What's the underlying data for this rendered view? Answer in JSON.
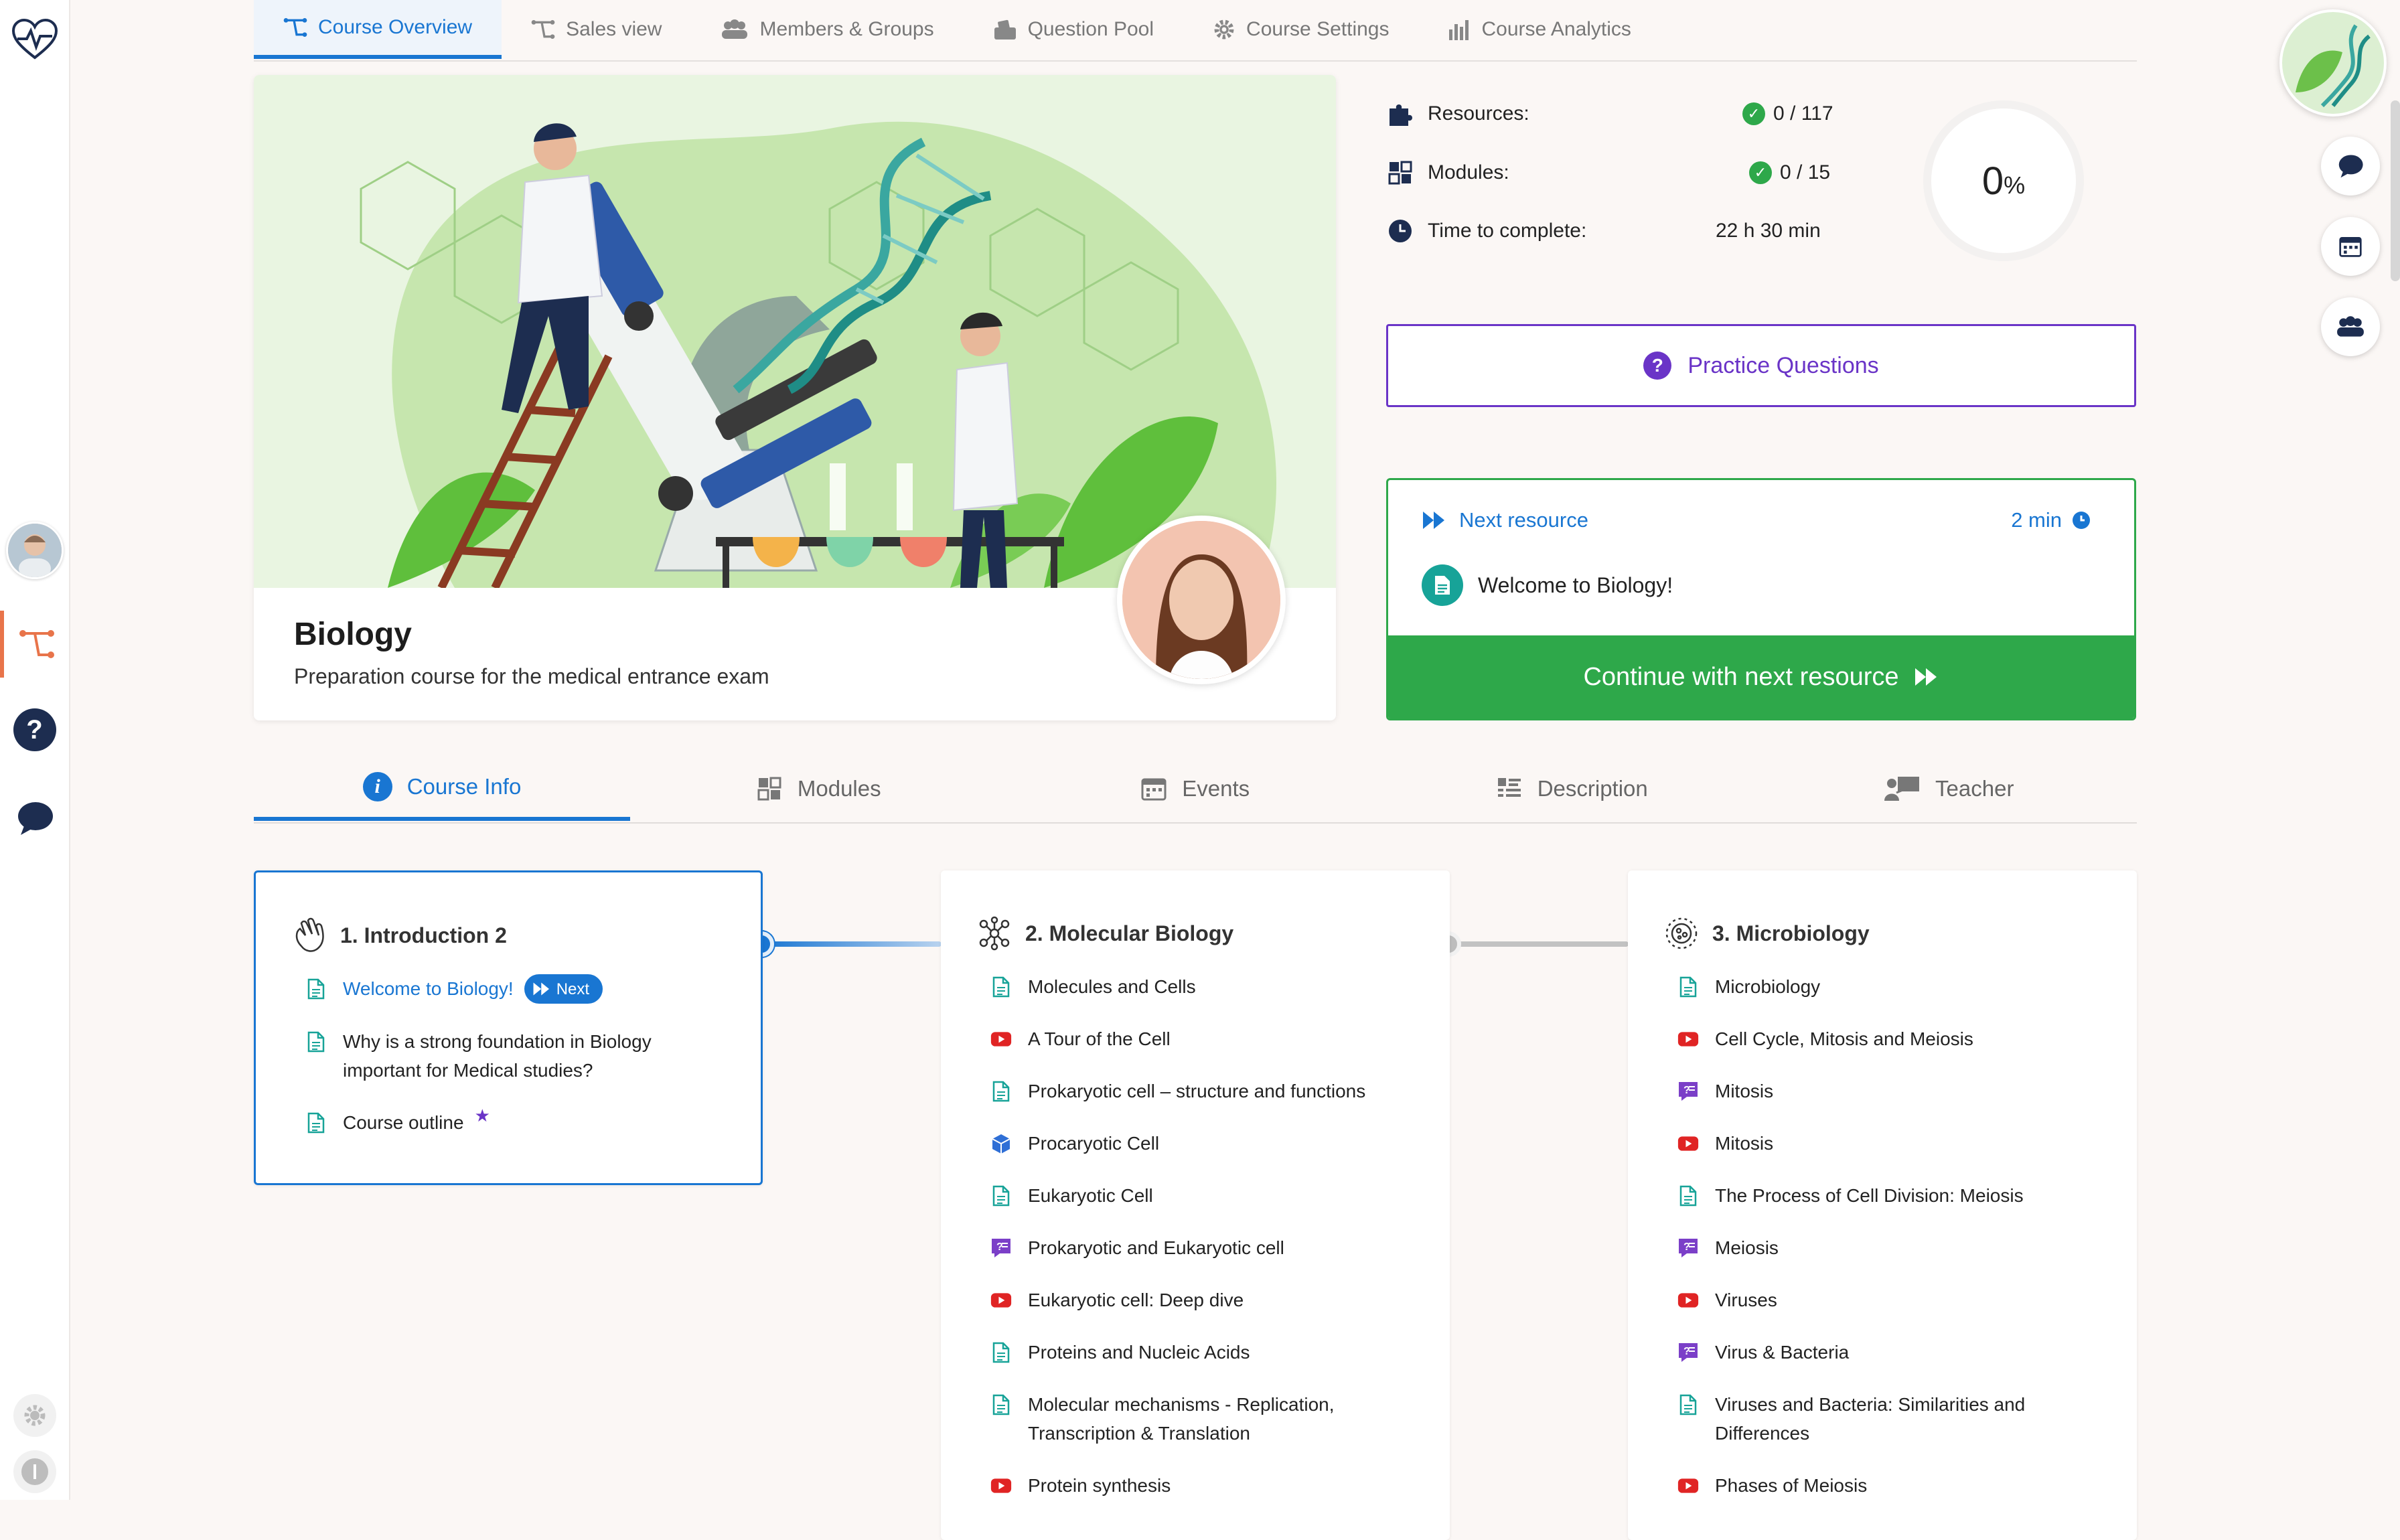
{
  "top_tabs": [
    {
      "label": "Course Overview",
      "icon": "course-overview-icon",
      "active": true
    },
    {
      "label": "Sales view",
      "icon": "sales-view-icon",
      "active": false
    },
    {
      "label": "Members & Groups",
      "icon": "members-icon",
      "active": false
    },
    {
      "label": "Question Pool",
      "icon": "question-pool-icon",
      "active": false
    },
    {
      "label": "Course Settings",
      "icon": "gear-icon",
      "active": false
    },
    {
      "label": "Course Analytics",
      "icon": "analytics-icon",
      "active": false
    }
  ],
  "course": {
    "title": "Biology",
    "subtitle": "Preparation course for the medical entrance exam"
  },
  "stats": {
    "resources_label": "Resources:",
    "resources_value": "0 / 117",
    "modules_label": "Modules:",
    "modules_value": "0 / 15",
    "time_label": "Time to complete:",
    "time_value": "22 h 30 min",
    "progress_number": "0",
    "progress_unit": "%"
  },
  "practice": {
    "label": "Practice Questions"
  },
  "next_resource": {
    "label": "Next resource",
    "duration": "2 min",
    "title": "Welcome to Biology!",
    "continue_label": "Continue with next resource"
  },
  "info_tabs": [
    {
      "label": "Course Info",
      "active": true
    },
    {
      "label": "Modules",
      "active": false
    },
    {
      "label": "Events",
      "active": false
    },
    {
      "label": "Description",
      "active": false
    },
    {
      "label": "Teacher",
      "active": false
    }
  ],
  "modules": [
    {
      "title": "1. Introduction 2",
      "items": [
        {
          "label": "Welcome to Biology!",
          "type": "document",
          "next": true,
          "next_label": "Next"
        },
        {
          "label": "Why is a strong foundation in Biology important for Medical studies?",
          "type": "document"
        },
        {
          "label": "Course outline",
          "type": "document",
          "star": true
        }
      ]
    },
    {
      "title": "2. Molecular Biology",
      "items": [
        {
          "label": "Molecules and Cells",
          "type": "document"
        },
        {
          "label": "A Tour of the Cell",
          "type": "video"
        },
        {
          "label": "Prokaryotic cell – structure and functions",
          "type": "document"
        },
        {
          "label": "Procaryotic Cell",
          "type": "3d"
        },
        {
          "label": "Eukaryotic Cell",
          "type": "document"
        },
        {
          "label": "Prokaryotic and Eukaryotic cell",
          "type": "quiz"
        },
        {
          "label": "Eukaryotic cell: Deep dive",
          "type": "video"
        },
        {
          "label": "Proteins and Nucleic Acids",
          "type": "document"
        },
        {
          "label": "Molecular mechanisms - Replication, Transcription & Translation",
          "type": "document"
        },
        {
          "label": "Protein synthesis",
          "type": "video"
        }
      ]
    },
    {
      "title": "3. Microbiology",
      "items": [
        {
          "label": "Microbiology",
          "type": "document"
        },
        {
          "label": "Cell Cycle, Mitosis and Meiosis",
          "type": "video"
        },
        {
          "label": "Mitosis",
          "type": "quiz"
        },
        {
          "label": "Mitosis",
          "type": "video"
        },
        {
          "label": "The Process of Cell Division: Meiosis",
          "type": "document"
        },
        {
          "label": "Meiosis",
          "type": "quiz"
        },
        {
          "label": "Viruses",
          "type": "video"
        },
        {
          "label": "Virus & Bacteria",
          "type": "quiz"
        },
        {
          "label": "Viruses and Bacteria: Similarities and Differences",
          "type": "document"
        },
        {
          "label": "Phases of Meiosis",
          "type": "video"
        }
      ]
    }
  ],
  "colors": {
    "accent": "#1976d2",
    "success": "#2ea84a",
    "practice": "#6a34c7",
    "sidebar_active": "#e8744a",
    "video": "#e02424",
    "document": "#17a398",
    "quiz": "#7b3fc8"
  }
}
